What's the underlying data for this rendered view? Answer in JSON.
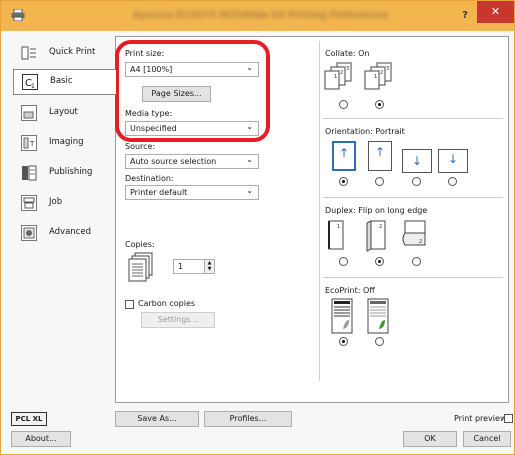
{
  "window": {
    "title": "Kyocera ECOSYS M2540dw KX Printing Preferences",
    "help": "?",
    "close": "✕"
  },
  "sidebar": {
    "items": [
      {
        "label": "Quick Print",
        "icon": "quick-print-icon"
      },
      {
        "label": "Basic",
        "icon": "basic-icon"
      },
      {
        "label": "Layout",
        "icon": "layout-icon"
      },
      {
        "label": "Imaging",
        "icon": "imaging-icon"
      },
      {
        "label": "Publishing",
        "icon": "publishing-icon"
      },
      {
        "label": "Job",
        "icon": "job-icon"
      },
      {
        "label": "Advanced",
        "icon": "advanced-icon"
      }
    ]
  },
  "basic": {
    "print_size_label": "Print size:",
    "print_size_value": "A4  [100%]",
    "page_sizes_button": "Page Sizes...",
    "media_type_label": "Media type:",
    "media_type_value": "Unspecified",
    "source_label": "Source:",
    "source_value": "Auto source selection",
    "destination_label": "Destination:",
    "destination_value": "Printer default",
    "copies_label": "Copies:",
    "copies_value": "1",
    "carbon_copies_label": "Carbon copies",
    "settings_button": "Settings..."
  },
  "right": {
    "collate_label": "Collate:  On",
    "orientation_label": "Orientation:  Portrait",
    "duplex_label": "Duplex:  Flip on long edge",
    "ecoprint_label": "EcoPrint:  Off",
    "collate_digits": [
      "3",
      "2",
      "1",
      "3",
      "2",
      "1"
    ],
    "duplex_digits": [
      "1",
      "2",
      "1",
      "2"
    ]
  },
  "footer": {
    "pdl_badge": "PCL XL",
    "save_as_button": "Save As...",
    "profiles_button": "Profiles...",
    "print_preview_label": "Print preview",
    "about_button": "About...",
    "ok_button": "OK",
    "cancel_button": "Cancel"
  },
  "colors": {
    "titlebar": "#f3b64f",
    "close": "#c7372f",
    "highlight": "#e61d25",
    "accent": "#2f6db5"
  }
}
